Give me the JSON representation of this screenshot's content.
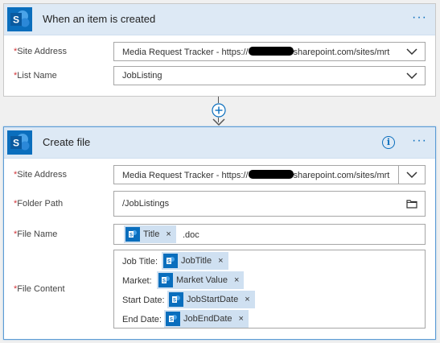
{
  "trigger": {
    "title": "When an item is created",
    "more_label": "···",
    "fields": [
      {
        "label": "Site Address",
        "value_prefix": "Media Request Tracker - https://",
        "value_suffix": "sharepoint.com/sites/mrt"
      },
      {
        "label": "List Name",
        "value": "JobListing"
      }
    ]
  },
  "action": {
    "title": "Create file",
    "info_label": "i",
    "more_label": "···",
    "required_mark": "*",
    "site_address": {
      "label": "Site Address",
      "value_prefix": "Media Request Tracker - https://",
      "value_suffix": "sharepoint.com/sites/mrt"
    },
    "folder_path": {
      "label": "Folder Path",
      "value": "/JobListings"
    },
    "file_name": {
      "label": "File Name",
      "token": "Title",
      "suffix": ".doc"
    },
    "file_content": {
      "label": "File Content",
      "lines": [
        {
          "prefix": "Job Title:",
          "token": "JobTitle"
        },
        {
          "prefix": "Market:",
          "token": "Market Value"
        },
        {
          "prefix": "Start Date:",
          "token": "JobStartDate"
        },
        {
          "prefix": "End Date:",
          "token": "JobEndDate"
        }
      ]
    }
  },
  "token_remove": "×",
  "colors": {
    "brand": "#0a6ebd",
    "header_bg": "#dde9f5",
    "token_bg": "#cfe0f1",
    "required": "#d13438"
  }
}
